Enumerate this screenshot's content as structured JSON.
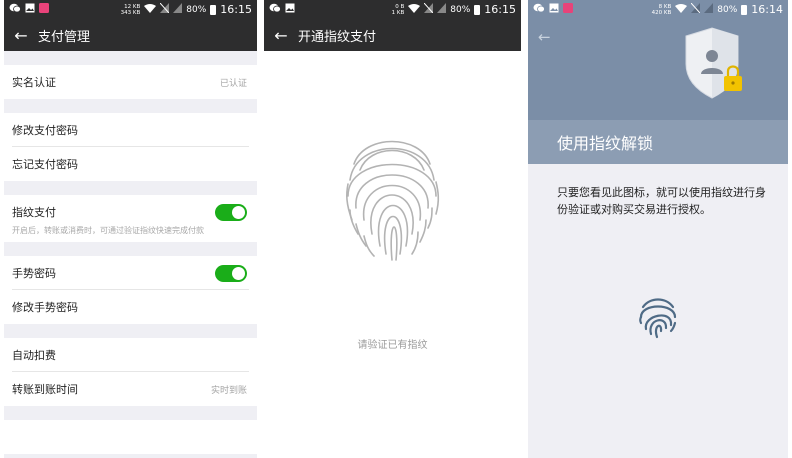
{
  "panel1": {
    "status": {
      "speed_top": "12 KB",
      "speed_bottom": "343 KB",
      "battery": "80%",
      "time": "16:15"
    },
    "title": "支付管理",
    "rows": {
      "realname": {
        "label": "实名认证",
        "value": "已认证"
      },
      "change_pwd": {
        "label": "修改支付密码"
      },
      "forgot_pwd": {
        "label": "忘记支付密码"
      },
      "fingerprint": {
        "label": "指纹支付",
        "enabled": true,
        "desc": "开启后，转账或消费时，可通过验证指纹快速完成付款"
      },
      "gesture": {
        "label": "手势密码",
        "enabled": true
      },
      "change_gesture": {
        "label": "修改手势密码"
      },
      "auto_deduct": {
        "label": "自动扣费"
      },
      "transfer_time": {
        "label": "转账到账时间",
        "value": "实时到账"
      }
    }
  },
  "panel2": {
    "status": {
      "speed_top": "0 B",
      "speed_bottom": "1 KB",
      "battery": "80%",
      "time": "16:15"
    },
    "title": "开通指纹支付",
    "hint": "请验证已有指纹"
  },
  "panel3": {
    "status": {
      "speed_top": "8 KB",
      "speed_bottom": "420 KB",
      "battery": "80%",
      "time": "16:14"
    },
    "heading": "使用指纹解锁",
    "description": "只要您看见此图标，就可以使用指纹进行身份验证或对购买交易进行授权。"
  },
  "colors": {
    "toolbar": "#2d2d2e",
    "switch_on": "#1aad19",
    "hero": "#7b8ea7",
    "fingerprint_blue": "#4f6b86"
  }
}
